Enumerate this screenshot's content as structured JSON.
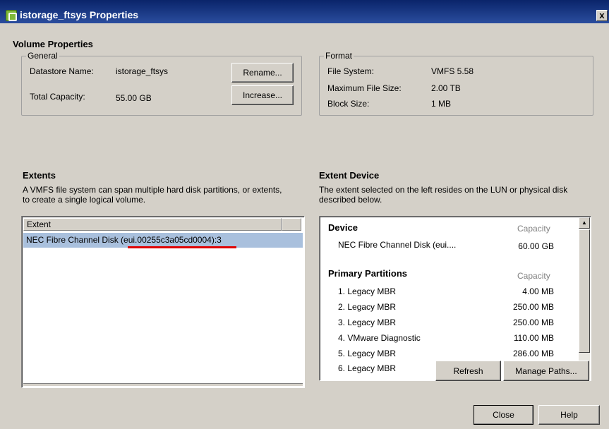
{
  "window": {
    "title": "istorage_ftsys Properties",
    "close_glyph": "x"
  },
  "volume_properties": {
    "title": "Volume Properties",
    "general": {
      "legend": "General",
      "datastore_name_label": "Datastore Name:",
      "datastore_name_value": "istorage_ftsys",
      "total_capacity_label": "Total Capacity:",
      "total_capacity_value": "55.00 GB",
      "rename_button": "Rename...",
      "increase_button": "Increase..."
    },
    "format": {
      "legend": "Format",
      "file_system_label": "File System:",
      "file_system_value": "VMFS 5.58",
      "max_file_size_label": "Maximum File Size:",
      "max_file_size_value": "2.00 TB",
      "block_size_label": "Block Size:",
      "block_size_value": "1 MB"
    }
  },
  "extents": {
    "title": "Extents",
    "description": "A VMFS file system can span multiple hard disk partitions, or extents, to create a single logical volume.",
    "column_header": "Extent",
    "rows": [
      {
        "label": "NEC Fibre Channel Disk (eui.00255c3a05cd0004):3",
        "selected": true
      }
    ]
  },
  "extent_device": {
    "title": "Extent Device",
    "description": "The extent selected on the left resides on the LUN or physical disk described below.",
    "device_header": "Device",
    "capacity_header": "Capacity",
    "device_name": "NEC Fibre Channel Disk (eui....",
    "device_capacity": "60.00 GB",
    "partitions_header": "Primary Partitions",
    "partitions_capacity_header": "Capacity",
    "partitions": [
      {
        "name": "1. Legacy MBR",
        "capacity": "4.00 MB"
      },
      {
        "name": "2. Legacy MBR",
        "capacity": "250.00 MB"
      },
      {
        "name": "3. Legacy MBR",
        "capacity": "250.00 MB"
      },
      {
        "name": "4. VMware Diagnostic",
        "capacity": "110.00 MB"
      },
      {
        "name": "5. Legacy MBR",
        "capacity": "286.00 MB"
      },
      {
        "name": "6. Legacy MBR",
        "capacity": ""
      }
    ],
    "refresh_button": "Refresh",
    "manage_paths_button": "Manage Paths..."
  },
  "footer": {
    "close_button": "Close",
    "help_button": "Help"
  },
  "colors": {
    "title_bar": "#0a246a",
    "selection": "#a9c0dd",
    "annotation_underline": "#e00000"
  }
}
